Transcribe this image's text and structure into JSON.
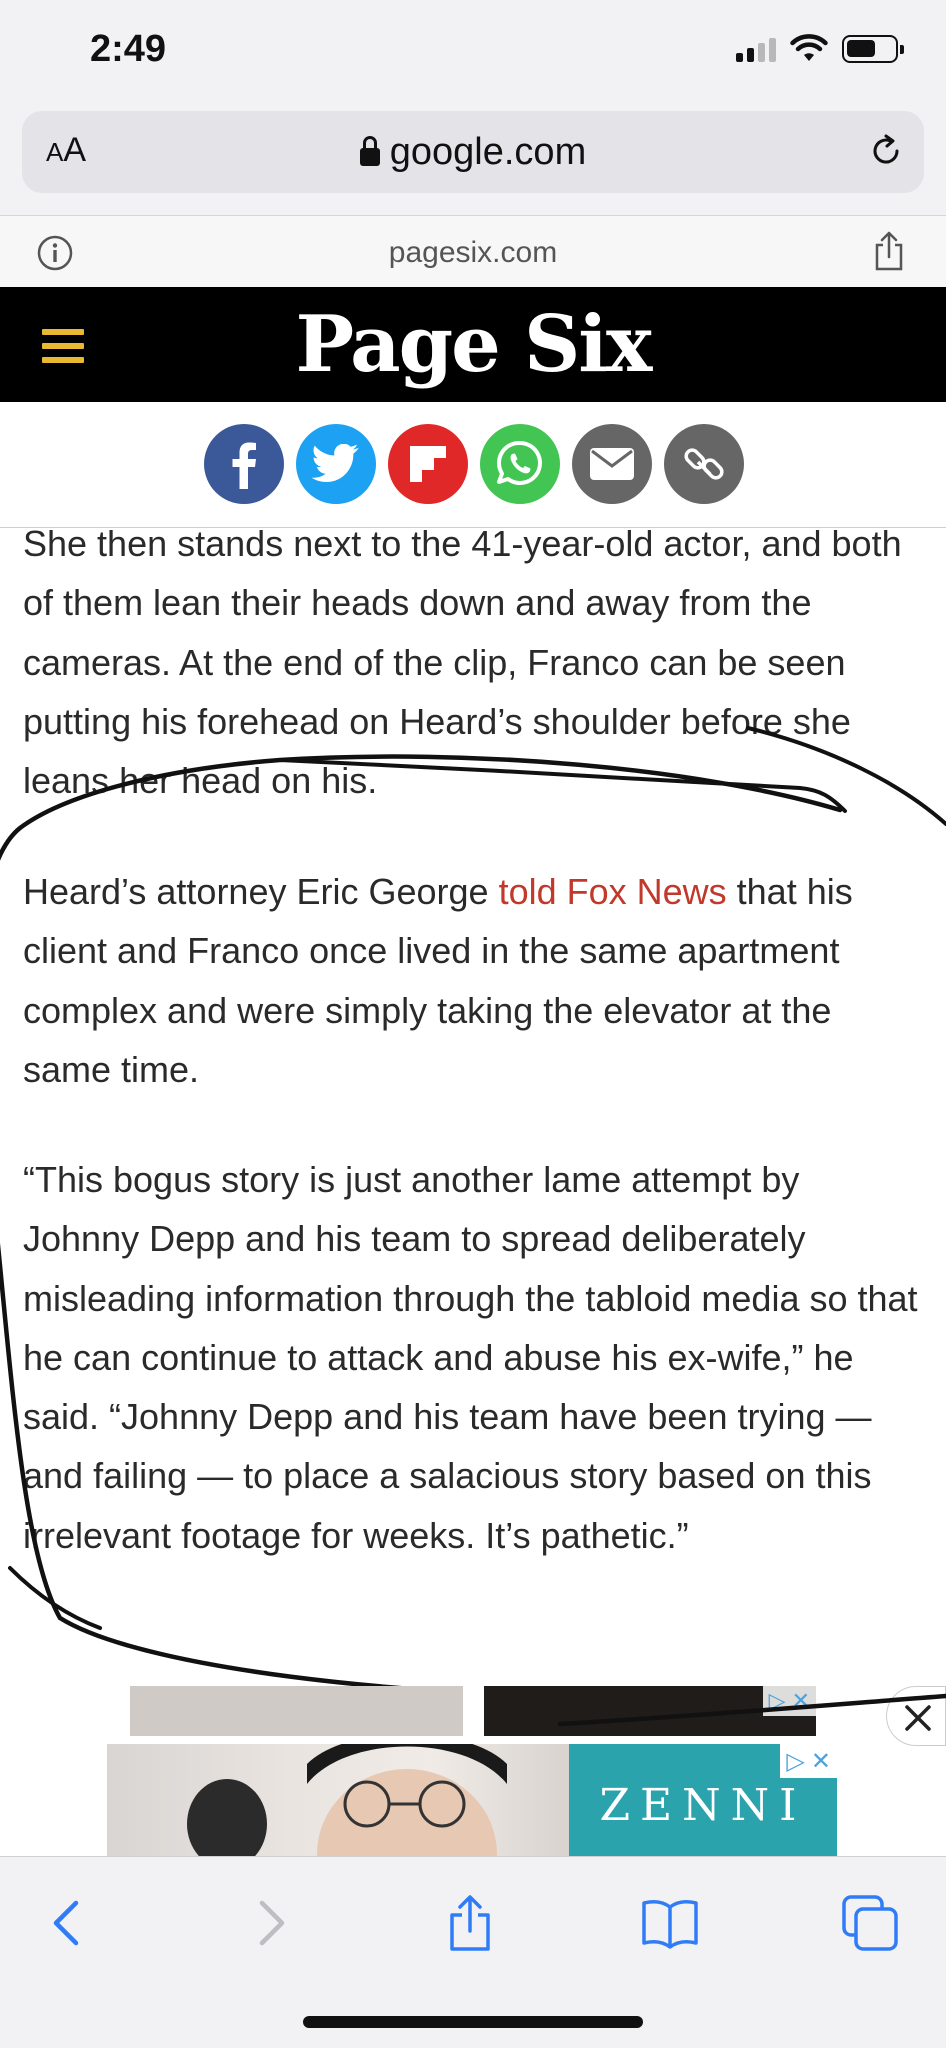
{
  "status_bar": {
    "time": "2:49"
  },
  "browser": {
    "aa_label_small": "A",
    "aa_label_large": "A",
    "url": "google.com",
    "domain": "pagesix.com"
  },
  "site": {
    "logo_text": "Page Six"
  },
  "share_buttons": [
    {
      "name": "facebook",
      "color": "#3b5998"
    },
    {
      "name": "twitter",
      "color": "#1da1f2"
    },
    {
      "name": "flipboard",
      "color": "#e12828"
    },
    {
      "name": "whatsapp",
      "color": "#43c553"
    },
    {
      "name": "email",
      "color": "#666666"
    },
    {
      "name": "copy-link",
      "color": "#666666"
    }
  ],
  "article": {
    "p1": "She then stands next to the 41-year-old actor, and both of them lean their heads down and away from the cameras. At the end of the clip, Franco can be seen putting his forehead on Heard’s shoulder before she leans her head on his.",
    "p2_before": "Heard’s attorney Eric George ",
    "p2_link": "told Fox News",
    "p2_after": " that his client and Franco once lived in the same apartment complex and were simply taking the elevator at the same time.",
    "p3": "“This bogus story is just another lame attempt by Johnny Depp and his team to spread deliberately misleading information through the tabloid media so that he can continue to attack and abuse his ex-wife,” he said. “Johnny Depp and his team have been trying — and failing — to place a salacious story based on this irrelevant footage for weeks. It’s pathetic.”"
  },
  "ad": {
    "brand": "ZENNI",
    "close_glyph": "✕"
  },
  "colors": {
    "link": "#c0392b",
    "menu_icon": "#e8b931",
    "ios_blue": "#2f7cf6"
  }
}
